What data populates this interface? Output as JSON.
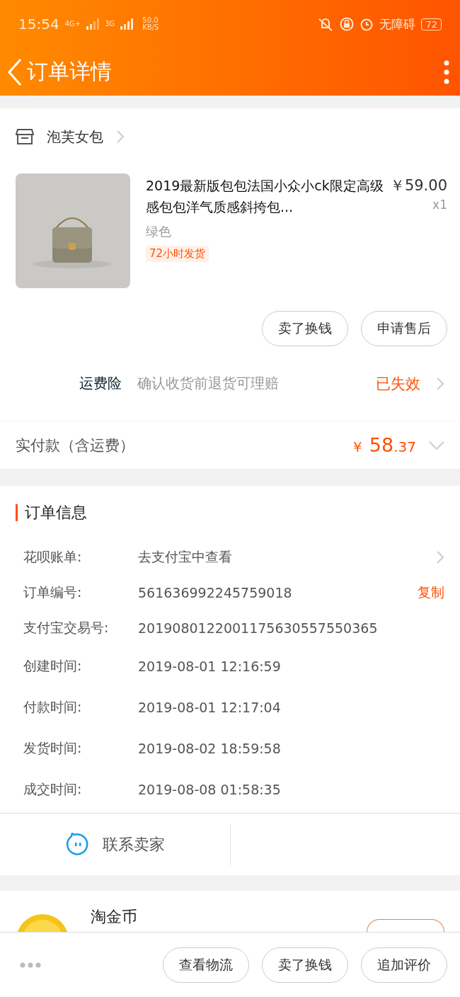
{
  "status_bar": {
    "time": "15:54",
    "network_1": "4G+",
    "network_2": "3G",
    "speed": "50.0",
    "speed_unit": "KB/S",
    "accessibility": "无障碍",
    "battery": "72"
  },
  "nav": {
    "title": "订单详情"
  },
  "shop": {
    "name": "泡芙女包"
  },
  "product": {
    "title": "2019最新版包包法国小众小ck限定高级感包包洋气质感斜挎包...",
    "price": "￥59.00",
    "quantity": "x1",
    "variant": "绿色",
    "tag": "72小时发货",
    "image": {
      "kind": "picture"
    },
    "buttons": [
      "卖了换钱",
      "申请售后"
    ]
  },
  "insurance": {
    "label": "运费险",
    "description": "确认收货前退货可理赔",
    "status": "已失效"
  },
  "payment": {
    "label": "实付款（含运费）",
    "currency": "￥",
    "amount_int": "58",
    "amount_dec": ".37"
  },
  "order_info": {
    "title": "订单信息",
    "rows": [
      {
        "kind": "link",
        "label": "花呗账单:",
        "value": "去支付宝中查看"
      },
      {
        "kind": "copy",
        "label": "订单编号:",
        "value": "561636992245759018",
        "action": "复制"
      },
      {
        "kind": "plain",
        "label": "支付宝交易号:",
        "value": "2019080122001175630557550365"
      },
      {
        "kind": "plain",
        "label": "创建时间:",
        "value": "2019-08-01 12:16:59"
      },
      {
        "kind": "plain",
        "label": "付款时间:",
        "value": "2019-08-01 12:17:04"
      },
      {
        "kind": "plain",
        "label": "发货时间:",
        "value": "2019-08-02 18:59:58"
      },
      {
        "kind": "plain",
        "label": "成交时间:",
        "value": "2019-08-08 01:58:35"
      }
    ]
  },
  "contact": {
    "label": "联系卖家"
  },
  "coins": {
    "title": "淘金币"
  },
  "bottom_bar": {
    "buttons": [
      "查看物流",
      "卖了换钱",
      "追加评价"
    ]
  }
}
